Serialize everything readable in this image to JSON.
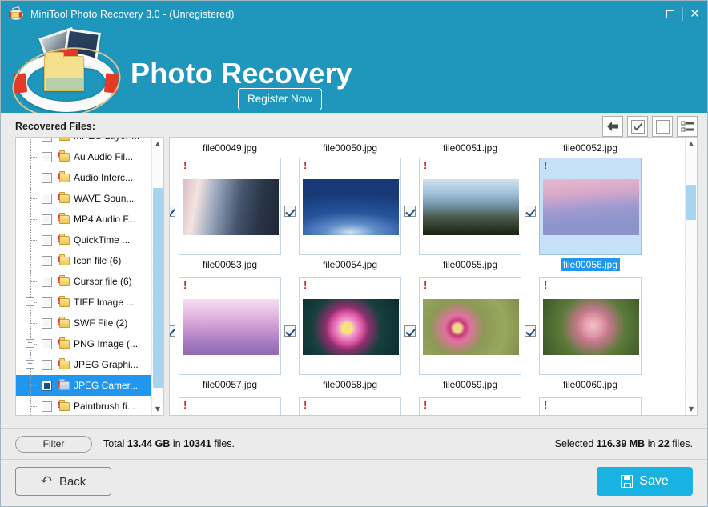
{
  "window": {
    "title": "MiniTool Photo Recovery 3.0 - (Unregistered)",
    "app_icon": "lifebuoy-icon",
    "minimize_label": "—",
    "maximize_label": "□",
    "close_label": "✕",
    "accent_color": "#1f97bd",
    "save_color": "#18b3e3",
    "selection_color": "#2196ef"
  },
  "banner": {
    "title": "Photo Recovery",
    "register_label": "Register Now",
    "logo_icon": "lifebuoy-photos-logo"
  },
  "left_pane": {
    "label": "Recovered Files:",
    "tree": [
      {
        "label": "MPEG Layer ...",
        "expandable": false,
        "checked": false,
        "selected": false
      },
      {
        "label": "Au Audio Fil...",
        "expandable": false,
        "checked": false,
        "selected": false
      },
      {
        "label": "Audio Interc...",
        "expandable": false,
        "checked": false,
        "selected": false
      },
      {
        "label": "WAVE Soun...",
        "expandable": false,
        "checked": false,
        "selected": false
      },
      {
        "label": "MP4 Audio F...",
        "expandable": false,
        "checked": false,
        "selected": false
      },
      {
        "label": "QuickTime ...",
        "expandable": false,
        "checked": false,
        "selected": false
      },
      {
        "label": "Icon file (6)",
        "expandable": false,
        "checked": false,
        "selected": false
      },
      {
        "label": "Cursor file (6)",
        "expandable": false,
        "checked": false,
        "selected": false
      },
      {
        "label": "TIFF Image ...",
        "expandable": true,
        "checked": false,
        "selected": false
      },
      {
        "label": "SWF File (2)",
        "expandable": false,
        "checked": false,
        "selected": false
      },
      {
        "label": "PNG Image (...",
        "expandable": true,
        "checked": false,
        "selected": false
      },
      {
        "label": "JPEG Graphi...",
        "expandable": true,
        "checked": false,
        "selected": false
      },
      {
        "label": "JPEG Camer...",
        "expandable": false,
        "checked": "partial",
        "selected": true
      },
      {
        "label": "Paintbrush fi...",
        "expandable": false,
        "checked": false,
        "selected": false
      }
    ]
  },
  "toolbar": {
    "buttons": [
      {
        "icon": "back-arrow-icon",
        "name": "toolbar-back-button"
      },
      {
        "icon": "check-all-icon",
        "name": "toolbar-select-all-button"
      },
      {
        "icon": "uncheck-all-icon",
        "name": "toolbar-deselect-all-button"
      },
      {
        "icon": "list-view-icon",
        "name": "toolbar-list-view-button"
      }
    ]
  },
  "files": {
    "row_partial_top": [
      {
        "name": "file00049.jpg"
      },
      {
        "name": "file00050.jpg"
      },
      {
        "name": "file00051.jpg"
      },
      {
        "name": "file00052.jpg"
      }
    ],
    "items": [
      {
        "name": "file00053.jpg",
        "checked": true,
        "selected": false,
        "warning": "!",
        "thumb": "lake-sunset-reflection"
      },
      {
        "name": "file00054.jpg",
        "checked": true,
        "selected": false,
        "warning": "!",
        "thumb": "milky-way-night-sky"
      },
      {
        "name": "file00055.jpg",
        "checked": true,
        "selected": false,
        "warning": "!",
        "thumb": "misty-mountain-ridges"
      },
      {
        "name": "file00056.jpg",
        "checked": true,
        "selected": true,
        "warning": "!",
        "thumb": "pink-volcano-mountain"
      },
      {
        "name": "file00057.jpg",
        "checked": true,
        "selected": false,
        "warning": "!",
        "thumb": "purple-foggy-forest"
      },
      {
        "name": "file00058.jpg",
        "checked": true,
        "selected": false,
        "warning": "!",
        "thumb": "pink-lotus-flower"
      },
      {
        "name": "file00059.jpg",
        "checked": true,
        "selected": false,
        "warning": "!",
        "thumb": "pink-poppy-flowers"
      },
      {
        "name": "file00060.jpg",
        "checked": true,
        "selected": false,
        "warning": "!",
        "thumb": "pink-berry-blossoms"
      }
    ],
    "row_partial_bottom_warning": "!"
  },
  "status": {
    "filter_label": "Filter",
    "total_prefix": "Total ",
    "total_size": "13.44 GB",
    "total_middle": " in ",
    "total_count": "10341",
    "total_suffix": " files.",
    "selected_prefix": "Selected ",
    "selected_size": "116.39 MB",
    "selected_middle": " in ",
    "selected_count": "22",
    "selected_suffix": " files."
  },
  "footer": {
    "back_label": "Back",
    "back_icon": "undo-arrow-icon",
    "save_label": "Save",
    "save_icon": "floppy-disk-icon"
  }
}
